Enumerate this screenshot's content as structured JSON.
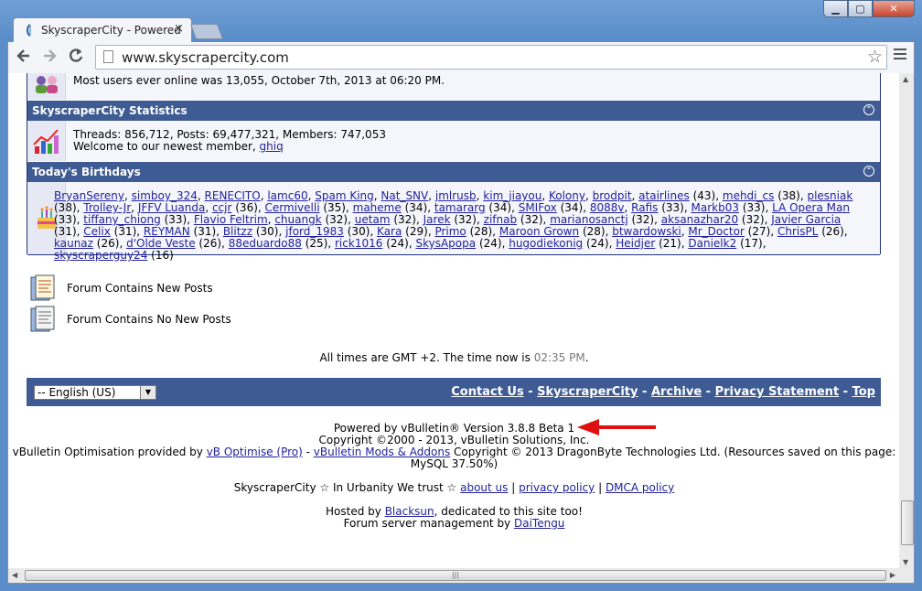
{
  "browser": {
    "tab_title": "SkyscraperCity - Powered",
    "tab_close": "×",
    "url": "www.skyscrapercity.com",
    "window_buttons": {
      "minimize": "▁",
      "maximize": "▢",
      "close": "✕"
    },
    "back_icon": "arrow-left",
    "forward_icon": "arrow-right",
    "reload_icon": "reload",
    "star_icon": "star-outline",
    "menu_icon": "hamburger-menu"
  },
  "online": {
    "text": "Most users ever online was 13,055, October 7th, 2013 at 06:20 PM."
  },
  "statistics": {
    "heading": "SkyscraperCity Statistics",
    "line1": "Threads: 856,712, Posts: 69,477,321, Members: 747,053",
    "welcome_prefix": "Welcome to our newest member, ",
    "newest_member": "ghiq"
  },
  "birthdays": {
    "heading": "Today's Birthdays",
    "people": [
      {
        "name": "BryanSereny",
        "age": ""
      },
      {
        "name": "simboy_324",
        "age": ""
      },
      {
        "name": "RENECITO",
        "age": ""
      },
      {
        "name": "lamc60",
        "age": ""
      },
      {
        "name": "Spam King",
        "age": ""
      },
      {
        "name": "Nat_SNV",
        "age": ""
      },
      {
        "name": "jmlrusb",
        "age": ""
      },
      {
        "name": "kim_jiayou",
        "age": ""
      },
      {
        "name": "Kolony",
        "age": ""
      },
      {
        "name": "brodpit",
        "age": ""
      },
      {
        "name": "atairlines",
        "age": "(43)"
      },
      {
        "name": "mehdi_cs",
        "age": "(38)"
      },
      {
        "name": "plesniak",
        "age": "(38)"
      },
      {
        "name": "Trolley-Jr",
        "age": ""
      },
      {
        "name": "JFFV Luanda",
        "age": ""
      },
      {
        "name": "ccjr",
        "age": "(36)"
      },
      {
        "name": "Cermivelli",
        "age": "(35)"
      },
      {
        "name": "maheme",
        "age": "(34)"
      },
      {
        "name": "tamararg",
        "age": "(34)"
      },
      {
        "name": "SMIFox",
        "age": "(34)"
      },
      {
        "name": "8088v",
        "age": ""
      },
      {
        "name": "Rafis",
        "age": "(33)"
      },
      {
        "name": "Markb03",
        "age": "(33)"
      },
      {
        "name": "LA Opera Man",
        "age": "(33)"
      },
      {
        "name": "tiffany_chiong",
        "age": "(33)"
      },
      {
        "name": "Flavio Feltrim",
        "age": ""
      },
      {
        "name": "chuangk",
        "age": "(32)"
      },
      {
        "name": "uetam",
        "age": "(32)"
      },
      {
        "name": "Jarek",
        "age": "(32)"
      },
      {
        "name": "zifnab",
        "age": "(32)"
      },
      {
        "name": "marianosanctj",
        "age": "(32)"
      },
      {
        "name": "aksanazhar20",
        "age": "(32)"
      },
      {
        "name": "Javier Garcia",
        "age": "(31)"
      },
      {
        "name": "Celix",
        "age": "(31)"
      },
      {
        "name": "REYMAN",
        "age": "(31)"
      },
      {
        "name": "Blitzz",
        "age": "(30)"
      },
      {
        "name": "jford_1983",
        "age": "(30)"
      },
      {
        "name": "Kara",
        "age": "(29)"
      },
      {
        "name": "Primo",
        "age": "(28)"
      },
      {
        "name": "Maroon Grown",
        "age": "(28)"
      },
      {
        "name": "btwardowski",
        "age": ""
      },
      {
        "name": "Mr_Doctor",
        "age": "(27)"
      },
      {
        "name": "ChrisPL",
        "age": "(26)"
      },
      {
        "name": "kaunaz",
        "age": "(26)"
      },
      {
        "name": "d'Olde Veste",
        "age": "(26)"
      },
      {
        "name": "88eduardo88",
        "age": "(25)"
      },
      {
        "name": "rick1016",
        "age": "(24)"
      },
      {
        "name": "SkysApopa",
        "age": "(24)"
      },
      {
        "name": "hugodiekonig",
        "age": "(24)"
      },
      {
        "name": "Heidjer",
        "age": "(21)"
      },
      {
        "name": "Danielk2",
        "age": "(17)"
      },
      {
        "name": "skyscraperguy24",
        "age": "(16)"
      }
    ]
  },
  "legend": {
    "new_posts": "Forum Contains New Posts",
    "no_new_posts": "Forum Contains No New Posts"
  },
  "time": {
    "prefix": "All times are GMT +2. The time now is ",
    "now": "02:35 PM",
    "suffix": "."
  },
  "footer": {
    "language": "-- English (US)",
    "links": [
      "Contact Us",
      "SkyscraperCity",
      "Archive",
      "Privacy Statement",
      "Top"
    ],
    "separator": " - "
  },
  "credits": {
    "powered": "Powered by vBulletin® Version 3.8.8 Beta 1",
    "copyright": "Copyright ©2000 - 2013, vBulletin Solutions, Inc.",
    "optimisation_prefix": "vBulletin Optimisation provided by ",
    "optimise_link": "vB Optimise (Pro)",
    "mods_sep": " - ",
    "mods_link": "vBulletin Mods & Addons",
    "mods_suffix": " Copyright © 2013 DragonByte Technologies Ltd. (Resources saved on this page:",
    "mysql": "MySQL 37.50%)",
    "trust_prefix": "SkyscraperCity ☆ In Urbanity We trust ☆ ",
    "about": "about us",
    "pipe": " | ",
    "privacy": "privacy policy",
    "dmca": "DMCA policy",
    "hosted_prefix": "Hosted by ",
    "host": "Blacksun",
    "hosted_suffix": ", dedicated to this site too!",
    "mgmt_prefix": "Forum server management by ",
    "mgmt": "DaiTengu"
  },
  "colors": {
    "header_blue": "#3f5b93",
    "link": "#22229c",
    "annotation_arrow": "#e01010"
  }
}
